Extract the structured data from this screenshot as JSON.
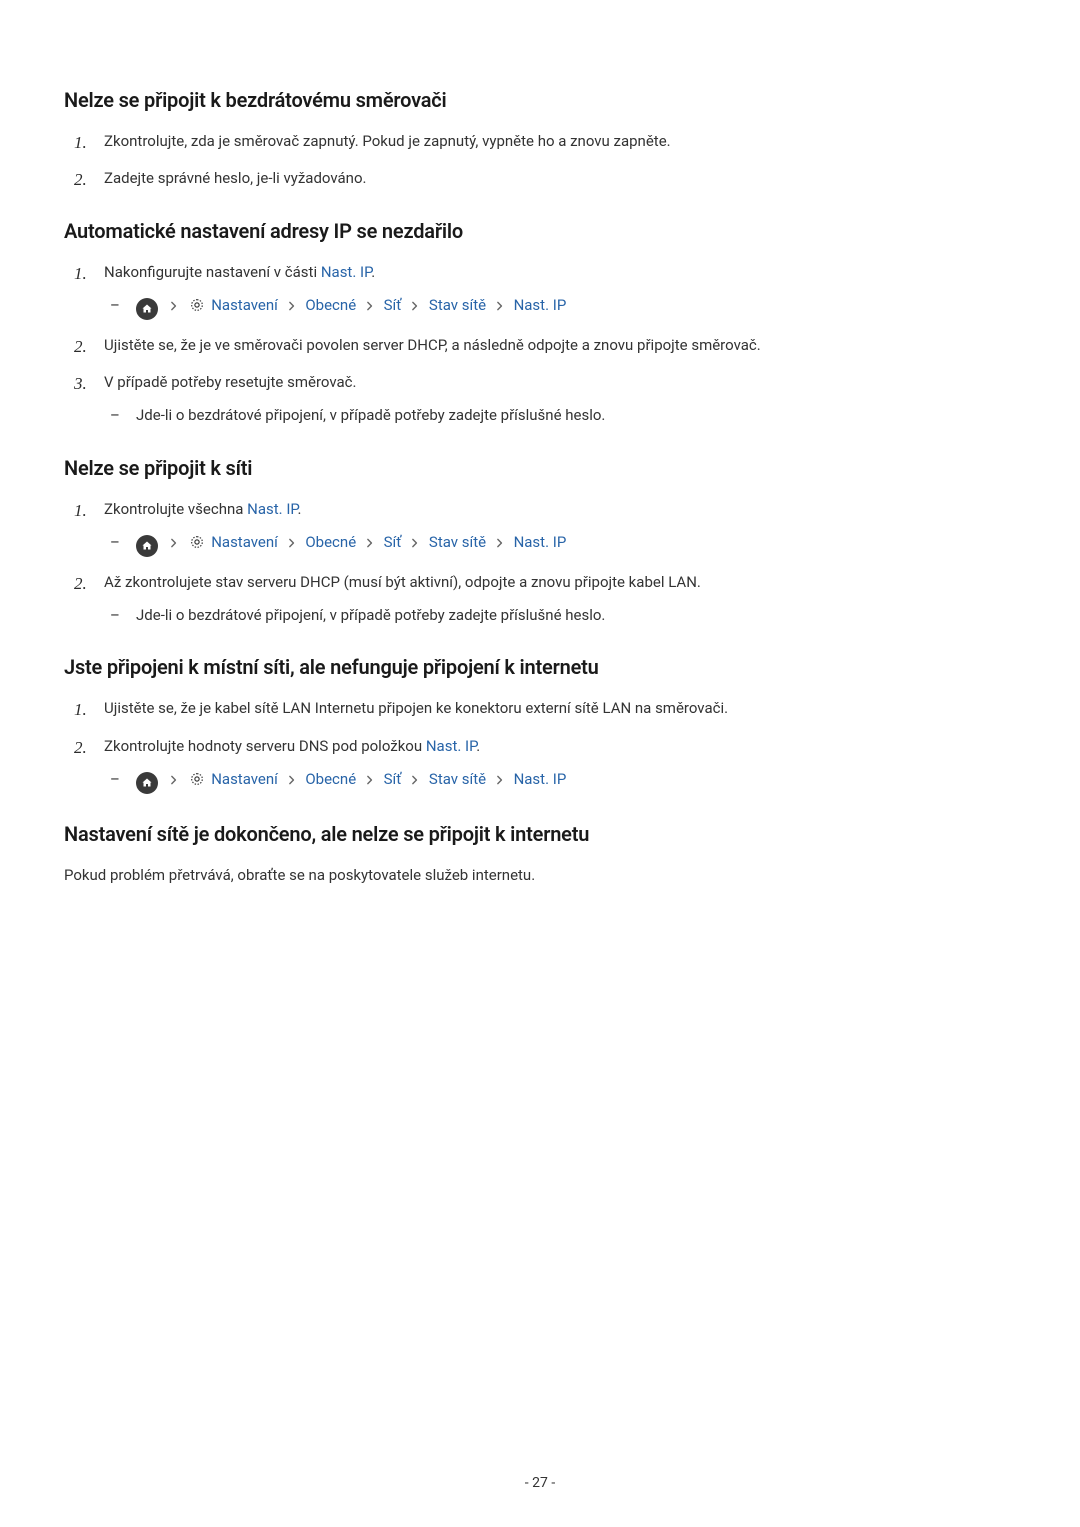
{
  "sections": [
    {
      "heading": "Nelze se připojit k bezdrátovému směrovači",
      "s1_li1": "Zkontrolujte, zda je směrovač zapnutý. Pokud je zapnutý, vypněte ho a znovu zapněte.",
      "s1_li2": "Zadejte správné heslo, je-li vyžadováno."
    },
    {
      "heading": "Automatické nastavení adresy IP se nezdařilo",
      "s2_li1_pre": "Nakonfigurujte nastavení v části ",
      "s2_li1_link": "Nast. IP",
      "s2_li1_post": ".",
      "s2_li2": "Ujistěte se, že je ve směrovači povolen server DHCP, a následně odpojte a znovu připojte směrovač.",
      "s2_li3": "V případě potřeby resetujte směrovač.",
      "s2_li3_sub": "Jde-li o bezdrátové připojení, v případě potřeby zadejte příslušné heslo."
    },
    {
      "heading": "Nelze se připojit k síti",
      "s3_li1_pre": "Zkontrolujte všechna ",
      "s3_li1_link": "Nast. IP",
      "s3_li1_post": ".",
      "s3_li2": "Až zkontrolujete stav serveru DHCP (musí být aktivní), odpojte a znovu připojte kabel LAN.",
      "s3_li2_sub": "Jde-li o bezdrátové připojení, v případě potřeby zadejte příslušné heslo."
    },
    {
      "heading": "Jste připojeni k místní síti, ale nefunguje připojení k internetu",
      "s4_li1": "Ujistěte se, že je kabel sítě LAN Internetu připojen ke konektoru externí sítě LAN na směrovači.",
      "s4_li2_pre": "Zkontrolujte hodnoty serveru DNS pod položkou ",
      "s4_li2_link": "Nast. IP",
      "s4_li2_post": "."
    },
    {
      "heading": "Nastavení sítě je dokončeno, ale nelze se připojit k internetu",
      "s5_p": "Pokud problém přetrvává, obraťte se na poskytovatele služeb internetu."
    }
  ],
  "nav": {
    "settings": "Nastavení",
    "general": "Obecné",
    "network": "Síť",
    "status": "Stav sítě",
    "ip": "Nast. IP"
  },
  "page_number": "- 27 -"
}
